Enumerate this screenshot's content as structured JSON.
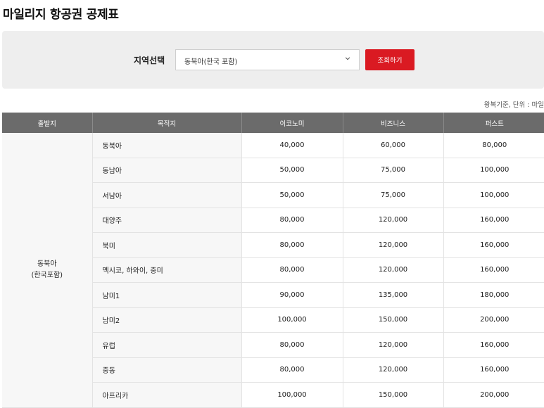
{
  "page": {
    "title": "마일리지 항공권 공제표"
  },
  "filter": {
    "label": "지역선택",
    "selected_region": "동북아(한국 포함)",
    "search_button": "조회하기"
  },
  "unit_note": "왕복기준, 단위 : 마일",
  "table": {
    "headers": [
      "출발지",
      "목적지",
      "이코노미",
      "비즈니스",
      "퍼스트"
    ],
    "origin_line1": "동북아",
    "origin_line2": "(한국포함)",
    "rows": [
      {
        "dest": "동북아",
        "economy": "40,000",
        "business": "60,000",
        "first": "80,000"
      },
      {
        "dest": "동남아",
        "economy": "50,000",
        "business": "75,000",
        "first": "100,000"
      },
      {
        "dest": "서남아",
        "economy": "50,000",
        "business": "75,000",
        "first": "100,000"
      },
      {
        "dest": "대양주",
        "economy": "80,000",
        "business": "120,000",
        "first": "160,000"
      },
      {
        "dest": "북미",
        "economy": "80,000",
        "business": "120,000",
        "first": "160,000"
      },
      {
        "dest": "멕시코, 하와이, 중미",
        "economy": "80,000",
        "business": "120,000",
        "first": "160,000"
      },
      {
        "dest": "남미1",
        "economy": "90,000",
        "business": "135,000",
        "first": "180,000"
      },
      {
        "dest": "남미2",
        "economy": "100,000",
        "business": "150,000",
        "first": "200,000"
      },
      {
        "dest": "유럽",
        "economy": "80,000",
        "business": "120,000",
        "first": "160,000"
      },
      {
        "dest": "중동",
        "economy": "80,000",
        "business": "120,000",
        "first": "160,000"
      },
      {
        "dest": "아프리카",
        "economy": "100,000",
        "business": "150,000",
        "first": "200,000"
      }
    ]
  },
  "icons": {
    "dropdown": "chevron-down-icon"
  },
  "colors": {
    "accent": "#da1a22",
    "header_bg": "#6b6b6b",
    "filter_bg": "#eeeeee"
  }
}
